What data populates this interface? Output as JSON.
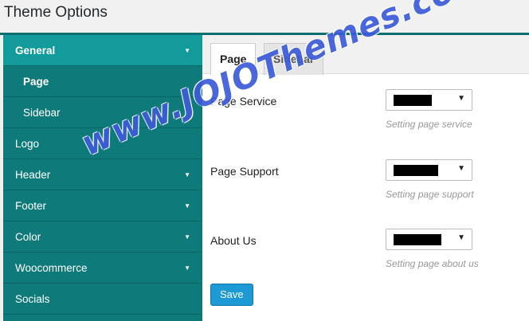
{
  "page": {
    "title": "Theme Options"
  },
  "sidebar": {
    "items": [
      {
        "label": "General",
        "active": true,
        "has_caret": true
      },
      {
        "label": "Page",
        "sub": true,
        "current": true
      },
      {
        "label": "Sidebar",
        "sub": true
      },
      {
        "label": "Logo"
      },
      {
        "label": "Header",
        "has_caret": true
      },
      {
        "label": "Footer",
        "has_caret": true
      },
      {
        "label": "Color",
        "has_caret": true
      },
      {
        "label": "Woocommerce",
        "has_caret": true
      },
      {
        "label": "Socials"
      }
    ],
    "caret_glyph": "▼"
  },
  "tabs": [
    {
      "label": "Page",
      "active": true
    },
    {
      "label": "Sidebar"
    }
  ],
  "fields": [
    {
      "label": "Page Service",
      "value": "",
      "hint": "Setting page service"
    },
    {
      "label": "Page Support",
      "value": "",
      "hint": "Setting page support"
    },
    {
      "label": "About Us",
      "value": "",
      "hint": "Setting page about us"
    }
  ],
  "select_arrow": "▼",
  "save_label": "Save",
  "watermark": "www.JOJOThemes.com",
  "colors": {
    "sidebar_bg": "#0f7a7a",
    "sidebar_active": "#139a9a",
    "save_button": "#1d9ad6",
    "watermark": "#3b5bd9"
  }
}
